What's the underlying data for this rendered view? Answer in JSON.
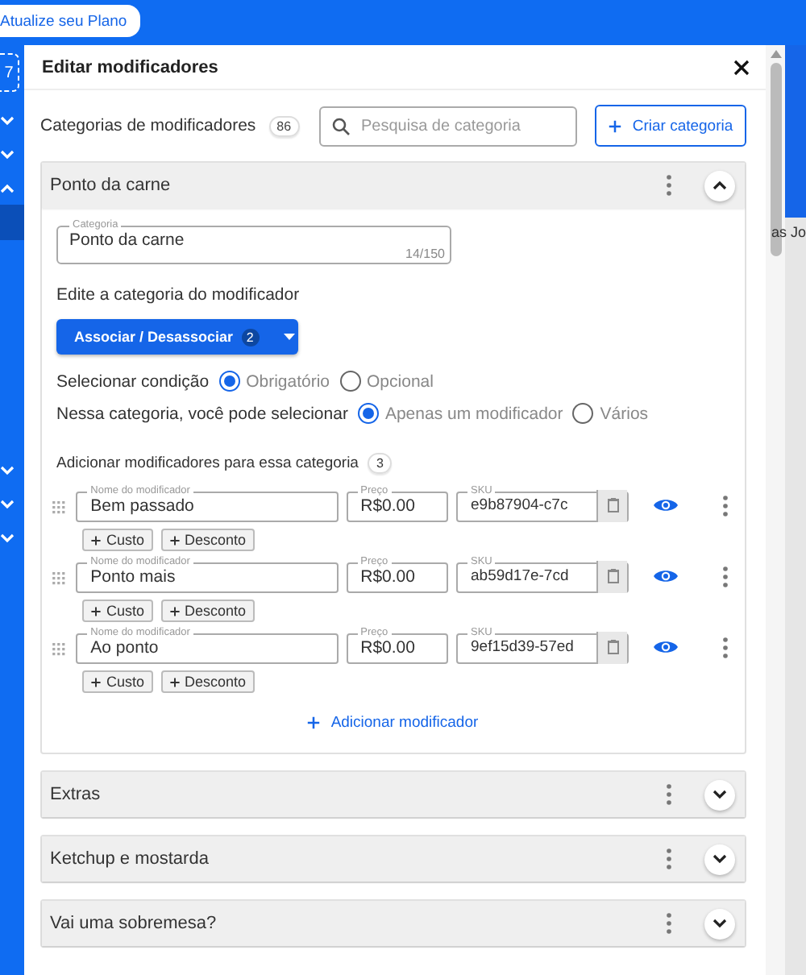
{
  "top_bar": {
    "upgrade_button": "Atualize seu Plano"
  },
  "sidebar": {
    "badge": "7",
    "toggles": [
      {
        "expanded": false
      },
      {
        "expanded": false
      },
      {
        "expanded": true
      },
      {
        "expanded": false
      },
      {
        "expanded": false
      },
      {
        "expanded": false
      }
    ]
  },
  "background_text": "as Jo",
  "dialog": {
    "title": "Editar modificadores",
    "toolbar": {
      "title": "Categorias de modificadores",
      "count": "86",
      "search": {
        "placeholder": "Pesquisa de categoria"
      },
      "create_button": "Criar categoria"
    },
    "categories": [
      {
        "name": "Ponto da carne",
        "expanded": true,
        "detail": {
          "category_field": {
            "label": "Categoria",
            "value": "Ponto da carne",
            "counter": "14/150"
          },
          "section_title": "Edite a categoria do modificador",
          "associate_button": {
            "label": "Associar / Desassociar",
            "count": "2"
          },
          "condition": {
            "label": "Selecionar condição",
            "options": [
              {
                "label": "Obrigatório",
                "selected": true
              },
              {
                "label": "Opcional",
                "selected": false
              }
            ]
          },
          "selection": {
            "label": "Nessa categoria, você pode selecionar",
            "options": [
              {
                "label": "Apenas um modificador",
                "selected": true
              },
              {
                "label": "Vários",
                "selected": false
              }
            ]
          },
          "modifiers_title": "Adicionar modificadores para essa categoria",
          "modifiers_count": "3",
          "modifiers": [
            {
              "name_label": "Nome do modificador",
              "name": "Bem passado",
              "price_label": "Preço",
              "price": "R$0.00",
              "sku_label": "SKU",
              "sku": "e9b87904-c7c",
              "visible": true,
              "cost_button": "Custo",
              "discount_button": "Desconto"
            },
            {
              "name_label": "Nome do modificador",
              "name": "Ponto mais",
              "price_label": "Preço",
              "price": "R$0.00",
              "sku_label": "SKU",
              "sku": "ab59d17e-7cd",
              "visible": true,
              "cost_button": "Custo",
              "discount_button": "Desconto"
            },
            {
              "name_label": "Nome do modificador",
              "name": "Ao ponto",
              "price_label": "Preço",
              "price": "R$0.00",
              "sku_label": "SKU",
              "sku": "9ef15d39-57ed",
              "visible": true,
              "cost_button": "Custo",
              "discount_button": "Desconto"
            }
          ],
          "add_button": "Adicionar modificador"
        }
      },
      {
        "name": "Extras",
        "expanded": false
      },
      {
        "name": "Ketchup e mostarda",
        "expanded": false
      },
      {
        "name": "Vai uma sobremesa?",
        "expanded": false
      }
    ]
  }
}
